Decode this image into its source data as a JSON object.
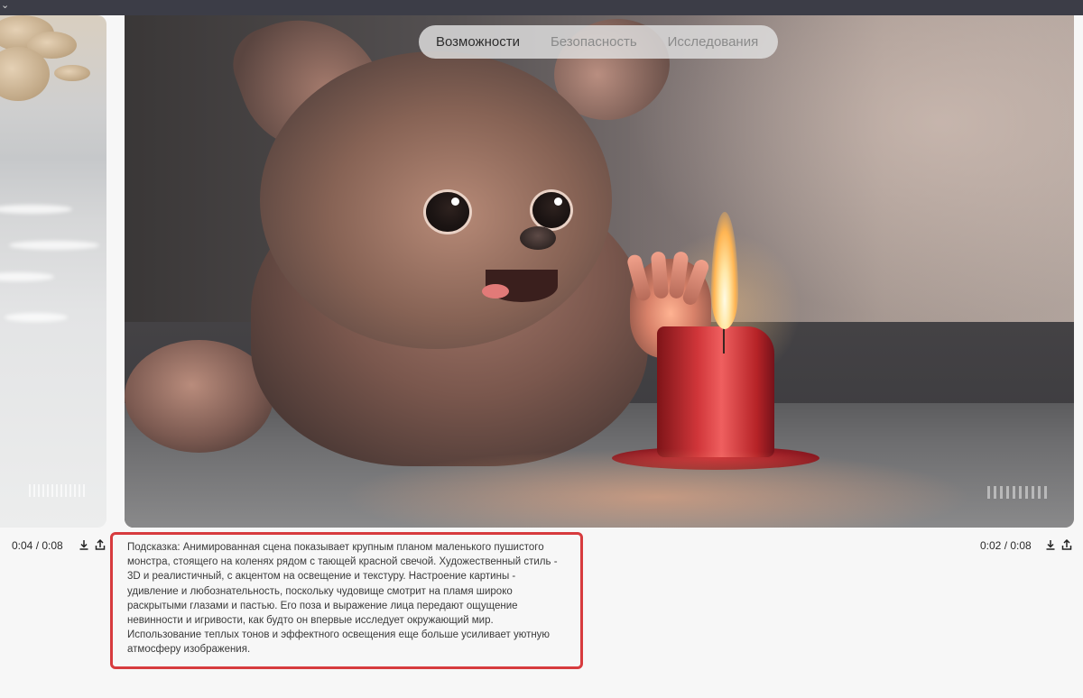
{
  "window": {
    "chevron_icon": "chevron-down-icon"
  },
  "nav": {
    "items": [
      {
        "label": "Возможности",
        "active": true
      },
      {
        "label": "Безопасность",
        "active": false
      },
      {
        "label": "Исследования",
        "active": false
      }
    ]
  },
  "left_video": {
    "time": "0:04 / 0:08",
    "download_icon": "download-icon",
    "share_icon": "share-icon"
  },
  "main_video": {
    "time": "0:02 / 0:08",
    "download_icon": "download-icon",
    "share_icon": "share-icon"
  },
  "prompt": {
    "text": "Подсказка: Анимированная сцена показывает крупным планом маленького пушистого монстра, стоящего на коленях рядом с тающей красной свечой. Художественный стиль - 3D и реалистичный, с акцентом на освещение и текстуру. Настроение картины - удивление и любознательность, поскольку чудовище смотрит на пламя широко раскрытыми глазами и пастью. Его поза и выражение лица передают ощущение невинности и игривости, как будто он впервые исследует окружающий мир. Использование теплых тонов и эффектного освещения еще больше усиливает уютную атмосферу изображения."
  },
  "colors": {
    "highlight_border": "#d73b3e",
    "top_bar": "#3c3d47",
    "background": "#f7f7f7"
  }
}
